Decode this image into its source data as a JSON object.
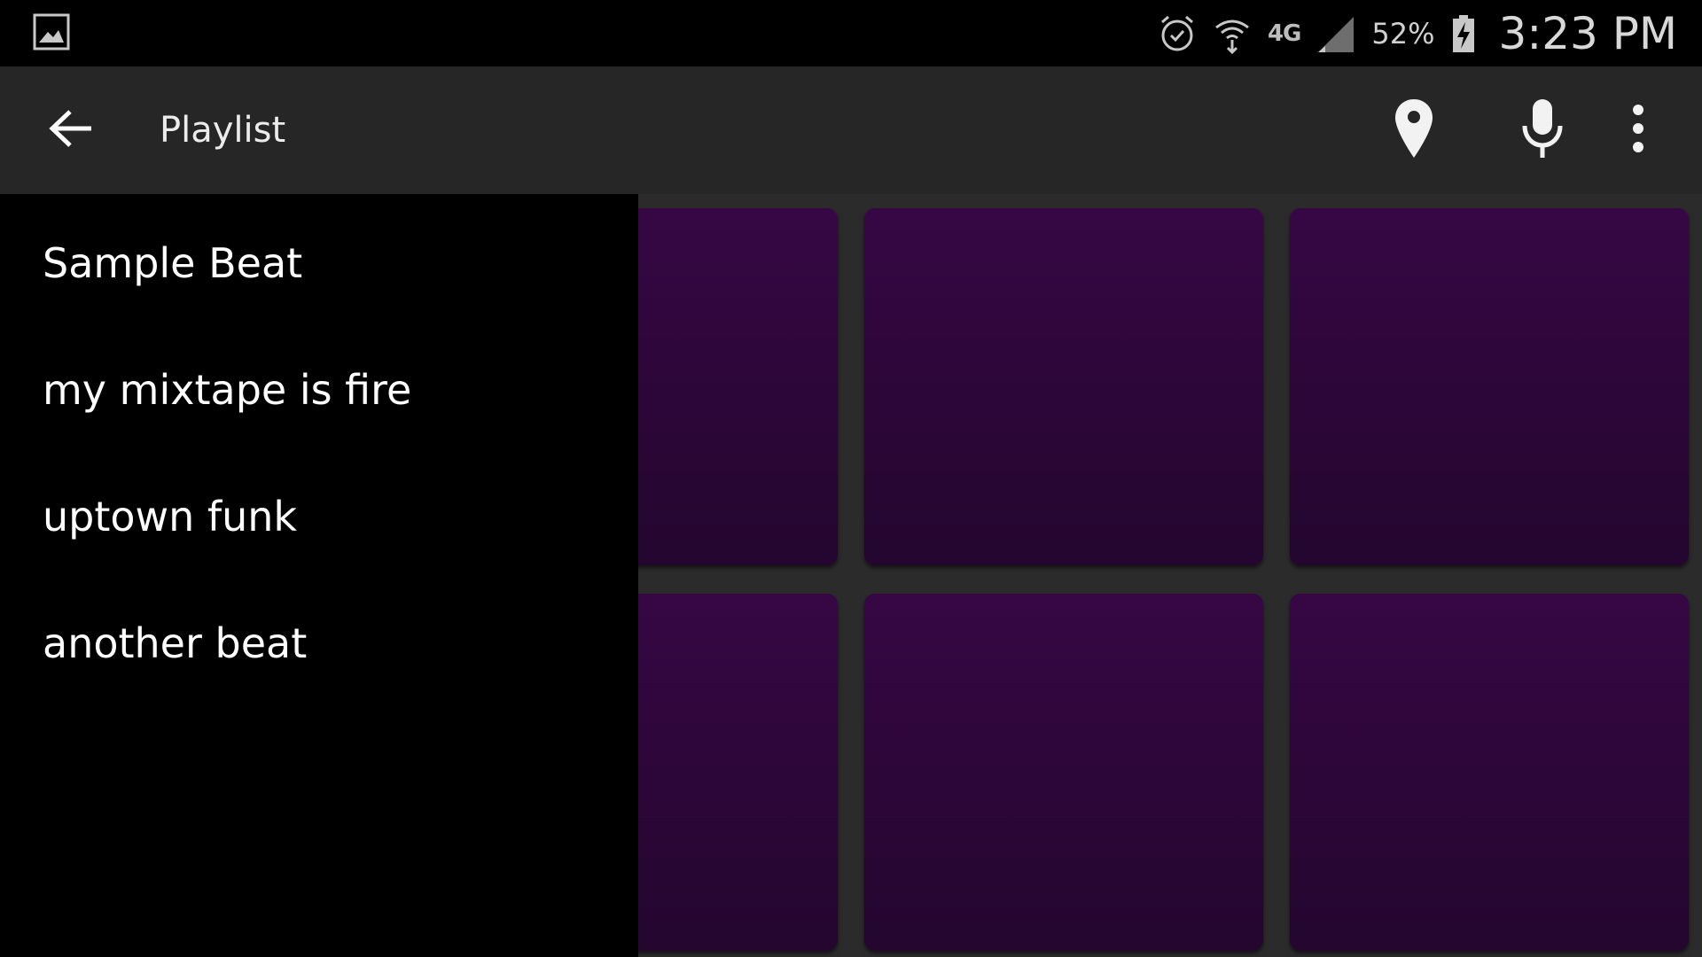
{
  "status_bar": {
    "battery_percent": "52%",
    "time": "3:23 PM",
    "network": "4G",
    "icons": [
      "gallery-icon",
      "alarm-icon",
      "wifi-icon",
      "network-4g-icon",
      "signal-icon",
      "battery-charging-icon"
    ]
  },
  "app_bar": {
    "title": "Playlist",
    "icons": [
      "back-arrow-icon",
      "location-pin-icon",
      "microphone-icon",
      "more-vert-icon"
    ]
  },
  "drawer": {
    "items": [
      {
        "label": "Sample Beat"
      },
      {
        "label": "my mixtape is fire"
      },
      {
        "label": "uptown funk"
      },
      {
        "label": "another beat"
      }
    ]
  },
  "pads": {
    "count": 6,
    "color": "#330640"
  },
  "colors": {
    "app_bar": "#262626",
    "drawer": "#000000",
    "background": "#2b2b2b",
    "pad_top": "#360744",
    "pad_bottom": "#24062f"
  }
}
